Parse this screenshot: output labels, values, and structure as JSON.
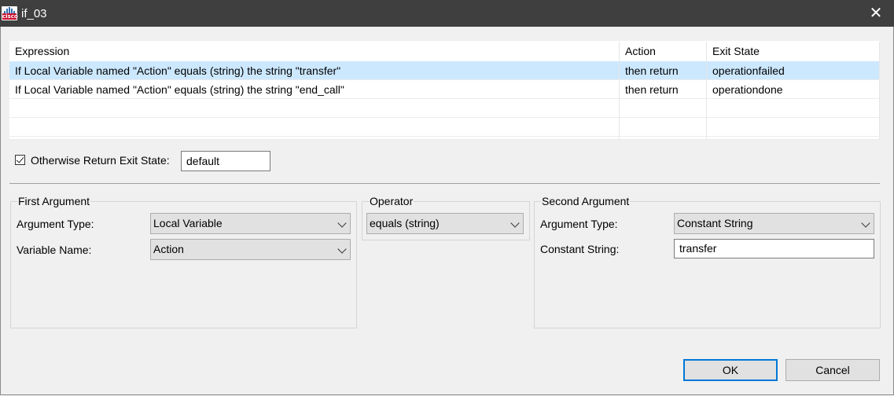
{
  "window": {
    "title": "if_03",
    "logo_text": "cisco",
    "close_glyph": "✕"
  },
  "table": {
    "columns": [
      "Expression",
      "Action",
      "Exit State"
    ],
    "rows": [
      {
        "expression": "If Local Variable named \"Action\" equals (string) the string \"transfer\"",
        "action": "then return",
        "exit_state": "operationfailed",
        "selected": true
      },
      {
        "expression": "If Local Variable named \"Action\" equals (string) the string \"end_call\"",
        "action": "then return",
        "exit_state": "operationdone",
        "selected": false
      }
    ]
  },
  "otherwise": {
    "label": "Otherwise Return Exit State:",
    "checked": true,
    "value": "default"
  },
  "first_argument": {
    "title": "First Argument",
    "argument_type_label": "Argument Type:",
    "argument_type_value": "Local Variable",
    "variable_name_label": "Variable Name:",
    "variable_name_value": "Action"
  },
  "operator": {
    "title": "Operator",
    "value": "equals (string)"
  },
  "second_argument": {
    "title": "Second Argument",
    "argument_type_label": "Argument Type:",
    "argument_type_value": "Constant String",
    "constant_string_label": "Constant String:",
    "constant_string_value": "transfer"
  },
  "buttons": {
    "ok": "OK",
    "cancel": "Cancel"
  },
  "colors": {
    "titlebar": "#3f3f3f",
    "selection": "#cce8ff",
    "default_button_border": "#0078d7"
  }
}
